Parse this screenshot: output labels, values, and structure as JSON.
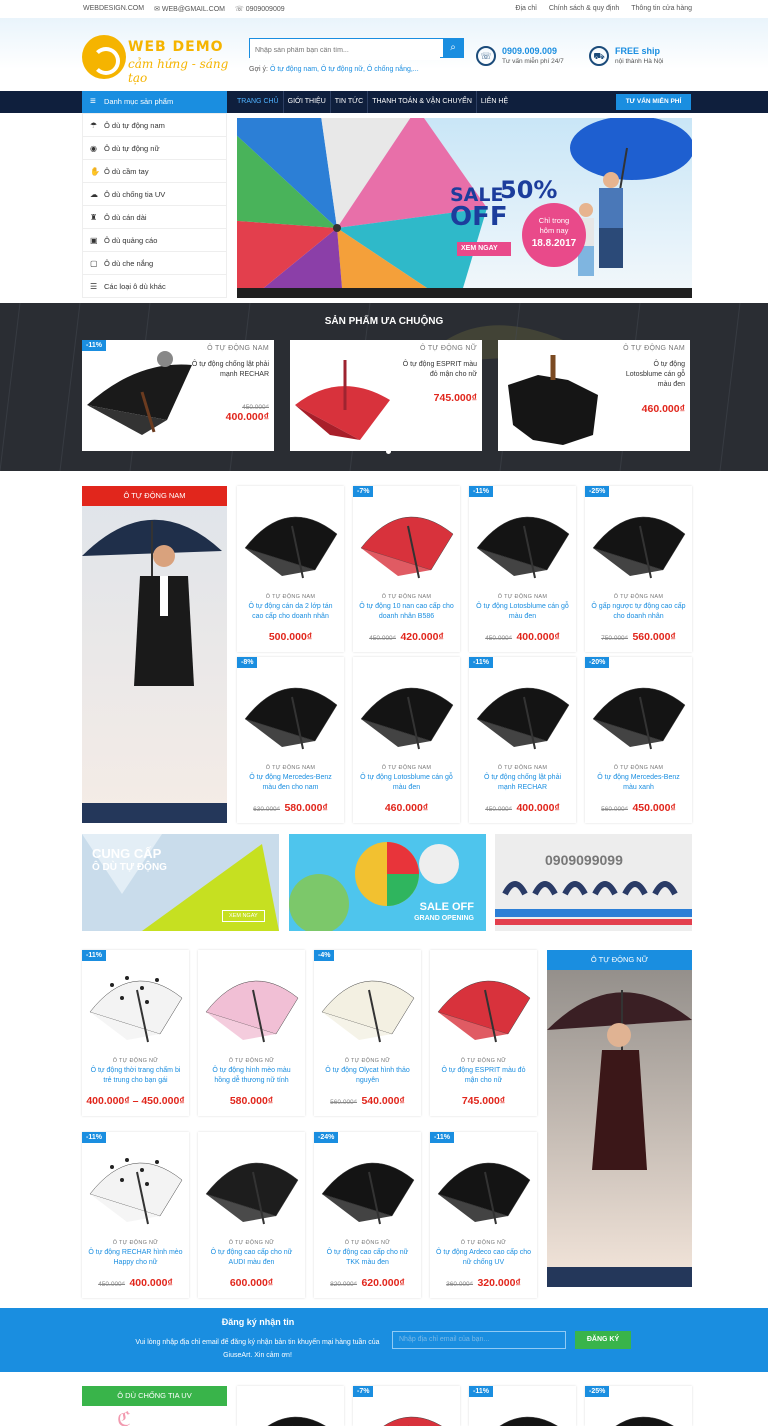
{
  "topbar": {
    "site": "WEBDESIGN.COM",
    "email": "WEB@GMAIL.COM",
    "phone": "0909009009",
    "links": [
      "Địa chỉ",
      "Chính sách & quy định",
      "Thông tin cửa hàng"
    ]
  },
  "logo": {
    "title": "WEB DEMO",
    "slogan": "cảm hứng - sáng tạo"
  },
  "search": {
    "placeholder": "Nhập sản phẩm bạn cần tìm...",
    "suggest_label": "Gợi ý:",
    "suggestions": "Ô tự động nam, Ô tự động nữ, Ô chống nắng,..."
  },
  "contact": {
    "hotline": "0909.009.009",
    "hotline_sub": "Tư vấn miễn phí 24/7",
    "ship": "FREE ship",
    "ship_sub": "nội thành Hà Nội"
  },
  "nav": {
    "category_label": "Danh mục sản phẩm",
    "menu": [
      "TRANG CHỦ",
      "GIỚI THIỆU",
      "TIN TỨC",
      "THANH TOÁN & VẬN CHUYỂN",
      "LIÊN HỆ"
    ],
    "consult": "TƯ VẤN MIỄN PHÍ"
  },
  "sidebar": {
    "items": [
      "Ô dù tự động nam",
      "Ô dù tự động nữ",
      "Ô dù cầm tay",
      "Ô dù chống tia UV",
      "Ô dù cán dài",
      "Ô dù quảng cáo",
      "Ô dù che nắng",
      "Các loại ô dù khác"
    ]
  },
  "banner": {
    "sale": "SALE",
    "percent": "50%",
    "off": "OFF",
    "only": "Chỉ trong",
    "today": "hôm nay",
    "date": "18.8.2017",
    "cta": "XEM NGAY"
  },
  "favorites": {
    "title": "SẢN PHẨM ƯA CHUỘNG",
    "items": [
      {
        "badge": "-11%",
        "cat": "Ô TỰ ĐỘNG NAM",
        "name": "Ô tự động chống lật phải mạnh RECHAR",
        "old": "450.000₫",
        "price": "400.000₫"
      },
      {
        "badge": "",
        "cat": "Ô TỰ ĐỘNG NỮ",
        "name": "Ô tự động ESPRIT màu đỏ mận cho nữ",
        "old": "",
        "price": "745.000₫"
      },
      {
        "badge": "",
        "cat": "Ô TỰ ĐỘNG NAM",
        "name": "Ô tự động Lotosblume cán gỗ màu đen",
        "old": "",
        "price": "460.000₫"
      }
    ]
  },
  "section_men": {
    "title": "Ô TỰ ĐỘNG NAM",
    "items": [
      {
        "badge": "",
        "cat": "Ô TỰ ĐỘNG NAM",
        "name": "Ô tự động cán da 2 lớp tán cao cấp cho doanh nhân",
        "old": "",
        "price": "500.000₫"
      },
      {
        "badge": "-7%",
        "cat": "Ô TỰ ĐỘNG NAM",
        "name": "Ô tự động 10 nan cao cấp cho doanh nhân B586",
        "old": "450.000₫",
        "price": "420.000₫"
      },
      {
        "badge": "-11%",
        "cat": "Ô TỰ ĐỘNG NAM",
        "name": "Ô tự động Lotosblume cán gỗ màu đen",
        "old": "450.000₫",
        "price": "400.000₫"
      },
      {
        "badge": "-25%",
        "cat": "Ô TỰ ĐỘNG NAM",
        "name": "Ô gấp ngược tự động cao cấp cho doanh nhân",
        "old": "750.000₫",
        "price": "560.000₫"
      },
      {
        "badge": "-8%",
        "cat": "Ô TỰ ĐỘNG NAM",
        "name": "Ô tự động Mercedes-Benz màu đen cho nam",
        "old": "630.000₫",
        "price": "580.000₫"
      },
      {
        "badge": "",
        "cat": "Ô TỰ ĐỘNG NAM",
        "name": "Ô tự động Lotosblume cán gỗ màu đen",
        "old": "",
        "price": "460.000₫"
      },
      {
        "badge": "-11%",
        "cat": "Ô TỰ ĐỘNG NAM",
        "name": "Ô tự động chống lật phải mạnh RECHAR",
        "old": "450.000₫",
        "price": "400.000₫"
      },
      {
        "badge": "-20%",
        "cat": "Ô TỰ ĐỘNG NAM",
        "name": "Ô tự động Mercedes-Benz màu xanh",
        "old": "560.000₫",
        "price": "450.000₫"
      }
    ]
  },
  "promos": [
    {
      "line1": "CUNG CẤP",
      "line2": "Ô DÙ TỰ ĐỘNG",
      "cta": "XEM NGAY"
    },
    {
      "line1": "SALE OFF",
      "line2": "GRAND OPENING"
    },
    {
      "phone": "0909099099"
    }
  ],
  "section_women": {
    "title": "Ô TỰ ĐỘNG NỮ",
    "items": [
      {
        "badge": "-11%",
        "cat": "Ô TỰ ĐỘNG NỮ",
        "name": "Ô tự động thời trang chấm bi trẻ trung cho bạn gái",
        "old": "",
        "price": "400.000₫ – 450.000₫"
      },
      {
        "badge": "",
        "cat": "Ô TỰ ĐỘNG NỮ",
        "name": "Ô tự động hình mèo màu hồng dễ thương nữ tính",
        "old": "",
        "price": "580.000₫"
      },
      {
        "badge": "-4%",
        "cat": "Ô TỰ ĐỘNG NỮ",
        "name": "Ô tự động Olycat hình thảo nguyên",
        "old": "560.000₫",
        "price": "540.000₫"
      },
      {
        "badge": "",
        "cat": "Ô TỰ ĐỘNG NỮ",
        "name": "Ô tự động ESPRIT màu đỏ mận cho nữ",
        "old": "",
        "price": "745.000₫"
      },
      {
        "badge": "-11%",
        "cat": "Ô TỰ ĐỘNG NỮ",
        "name": "Ô tự động RECHAR hình mèo Happy cho nữ",
        "old": "450.000₫",
        "price": "400.000₫"
      },
      {
        "badge": "",
        "cat": "Ô TỰ ĐỘNG NỮ",
        "name": "Ô tự động cao cấp cho nữ AUDI màu đen",
        "old": "",
        "price": "600.000₫"
      },
      {
        "badge": "-24%",
        "cat": "Ô TỰ ĐỘNG NỮ",
        "name": "Ô tự động cao cấp cho nữ TKK màu đen",
        "old": "820.000₫",
        "price": "620.000₫"
      },
      {
        "badge": "-11%",
        "cat": "Ô TỰ ĐỘNG NỮ",
        "name": "Ô tự động Ardeco cao cấp cho nữ chống UV",
        "old": "360.000₫",
        "price": "320.000₫"
      }
    ]
  },
  "newsletter": {
    "title": "Đăng ký nhận tin",
    "desc": "Vui lòng nhập địa chỉ email để đăng ký nhận bản tin khuyến mại hàng tuần của GiuseArt. Xin cảm ơn!",
    "placeholder": "Nhập địa chỉ email của bạn...",
    "button": "ĐĂNG KÝ"
  },
  "section_uv": {
    "title": "Ô DÙ CHỐNG TIA UV",
    "badges": [
      "-7%",
      "-11%",
      "-25%"
    ]
  },
  "colors": {
    "primary": "#1a8ee0",
    "nav": "#0f1f3d",
    "price": "#e1261c",
    "men_head": "#e1261c",
    "women_head": "#1a8ee0",
    "uv_head": "#39b44a",
    "logo": "#f5b400"
  }
}
